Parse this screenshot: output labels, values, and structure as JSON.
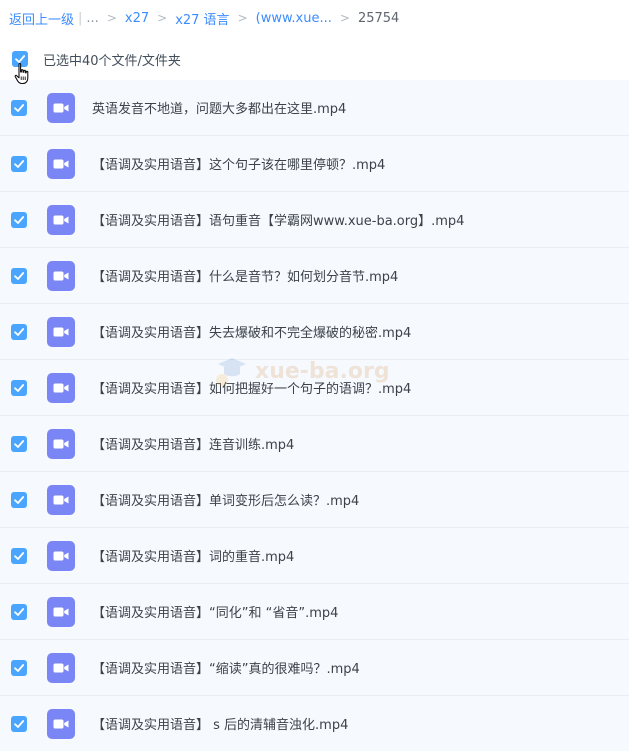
{
  "breadcrumb": {
    "back": "返回上一级",
    "ellipsis": "...",
    "items": [
      "x27",
      "x27 语言",
      "(www.xue...",
      "25754"
    ]
  },
  "selection": {
    "label": "已选中40个文件/文件夹"
  },
  "files": [
    {
      "name": "英语发音不地道，问题大多都出在这里.mp4"
    },
    {
      "name": "【语调及实用语音】这个句子该在哪里停顿？.mp4"
    },
    {
      "name": "【语调及实用语音】语句重音【学霸网www.xue-ba.org】.mp4"
    },
    {
      "name": "【语调及实用语音】什么是音节？如何划分音节.mp4"
    },
    {
      "name": "【语调及实用语音】失去爆破和不完全爆破的秘密.mp4"
    },
    {
      "name": "【语调及实用语音】如何把握好一个句子的语调？.mp4"
    },
    {
      "name": "【语调及实用语音】连音训练.mp4"
    },
    {
      "name": "【语调及实用语音】单词变形后怎么读？.mp4"
    },
    {
      "name": "【语调及实用语音】词的重音.mp4"
    },
    {
      "name": "【语调及实用语音】“同化”和 “省音”.mp4"
    },
    {
      "name": "【语调及实用语音】“缩读”真的很难吗？.mp4"
    },
    {
      "name": "【语调及实用语音】 s 后的清辅音浊化.mp4"
    }
  ],
  "watermark": {
    "text": "xue-ba.org"
  },
  "colors": {
    "accent": "#4aa5ff",
    "link": "#3b8cff",
    "row_background": "#f6faff",
    "video_icon": "#7a86f5"
  }
}
